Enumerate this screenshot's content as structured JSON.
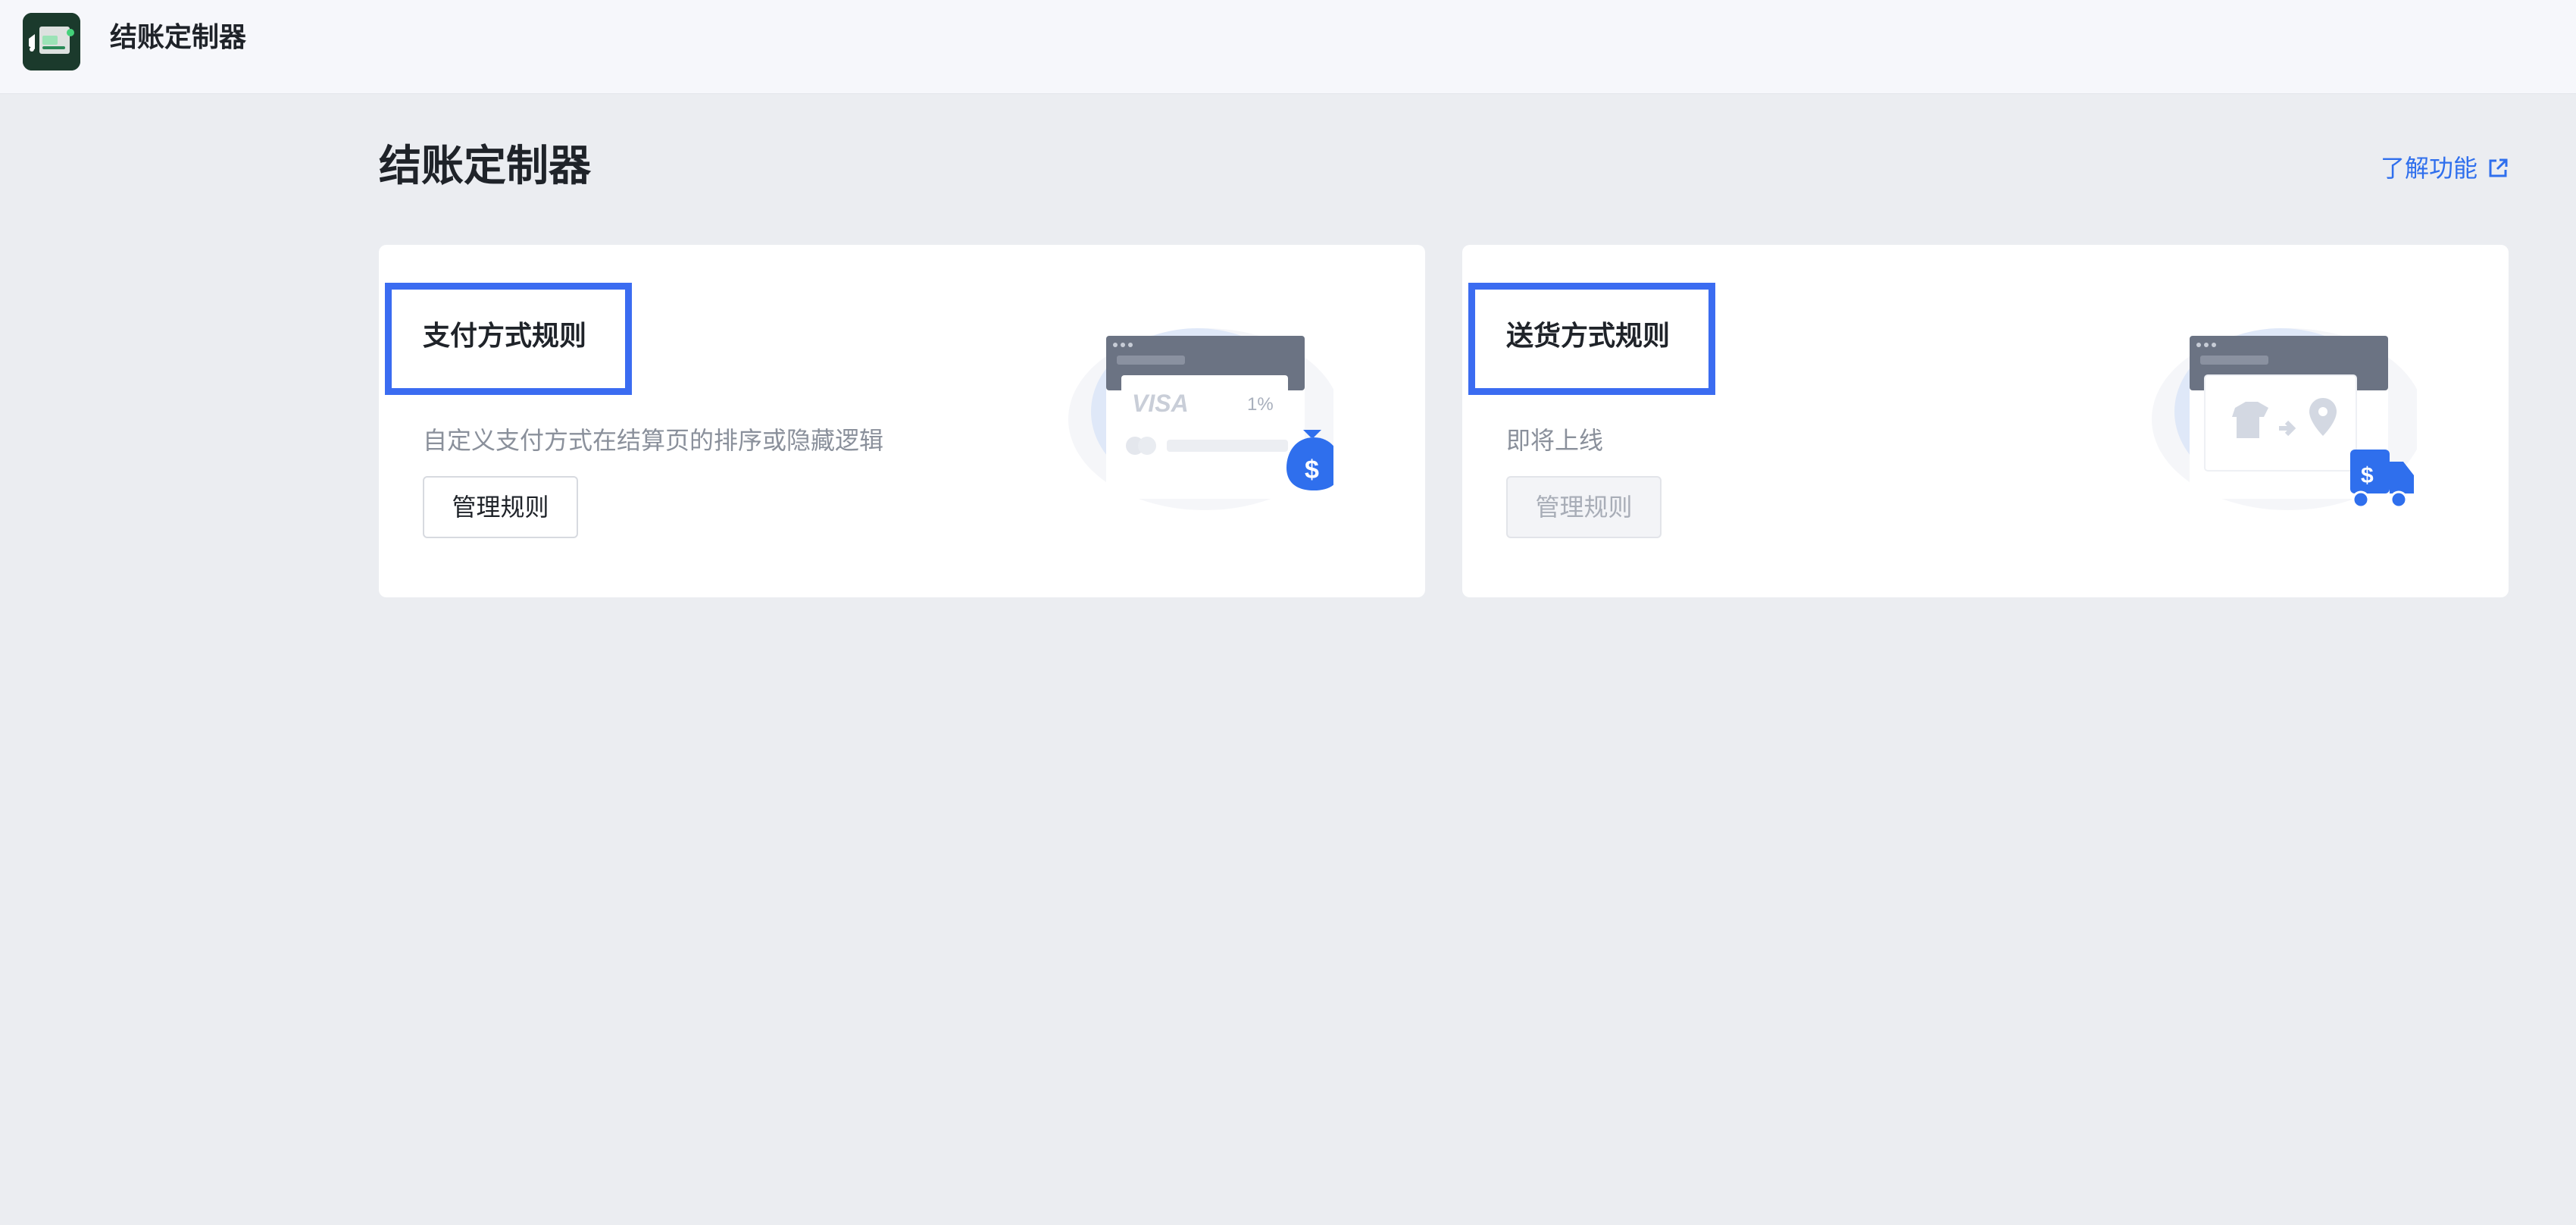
{
  "app": {
    "title": "结账定制器",
    "icon": "checkout-app-icon"
  },
  "page": {
    "title": "结账定制器",
    "learn_link": "了解功能"
  },
  "cards": [
    {
      "title": "支付方式规则",
      "description": "自定义支付方式在结算页的排序或隐藏逻辑",
      "button": "管理规则",
      "button_disabled": false,
      "illustration": {
        "card_brand": "VISA",
        "fee": "1%"
      }
    },
    {
      "title": "送货方式规则",
      "description": "即将上线",
      "button": "管理规则",
      "button_disabled": true
    }
  ],
  "colors": {
    "accent": "#2f6fed",
    "highlight_border": "#3b6cf1",
    "background": "#ebedf1",
    "topbar": "#f6f7fb"
  }
}
